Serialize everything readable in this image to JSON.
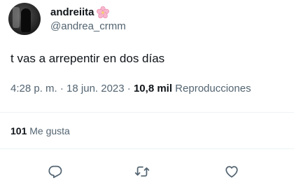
{
  "author": {
    "display_name": "andreiita",
    "handle": "@andrea_crmm",
    "name_emoji": "cherry-blossom-icon"
  },
  "tweet": {
    "text": "t vas a arrepentir en dos días"
  },
  "meta": {
    "time": "4:28 p. m.",
    "separator1": " · ",
    "date": "18 jun. 2023",
    "separator2": " · ",
    "views_count": "10,8 mil",
    "views_label": " Reproducciones"
  },
  "engagement": {
    "likes_count": "101",
    "likes_label": " Me gusta"
  },
  "actions": {
    "reply": "reply-icon",
    "retweet": "retweet-icon",
    "like": "heart-icon"
  },
  "colors": {
    "text_primary": "#0f1419",
    "text_secondary": "#536471",
    "divider": "#eff3f4",
    "icon": "#536471",
    "emoji_pink": "#f4a3c0"
  }
}
